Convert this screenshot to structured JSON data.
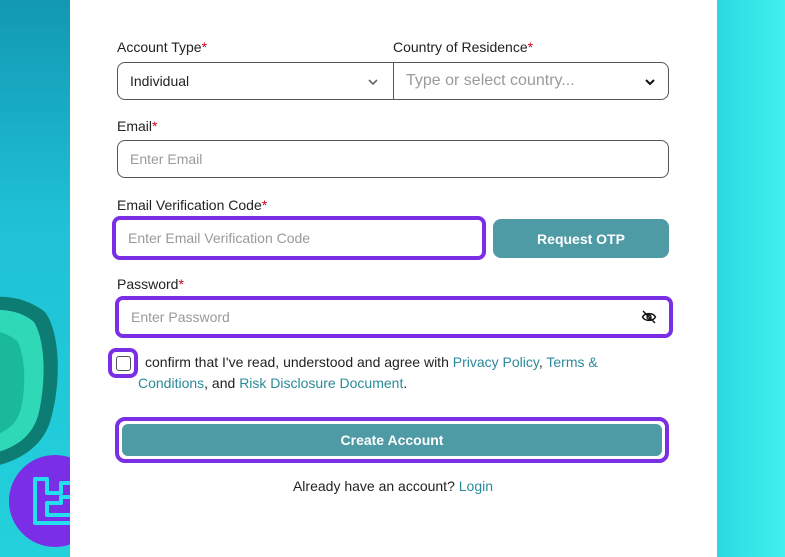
{
  "form": {
    "account_type": {
      "label": "Account Type",
      "required_mark": "*",
      "value": "Individual"
    },
    "country": {
      "label": "Country of Residence",
      "required_mark": "*",
      "placeholder": "Type or select country..."
    },
    "email": {
      "label": "Email",
      "required_mark": "*",
      "placeholder": "Enter Email"
    },
    "verification": {
      "label": "Email Verification Code",
      "required_mark": "*",
      "placeholder": "Enter Email Verification Code",
      "otp_button": "Request OTP"
    },
    "password": {
      "label": "Password",
      "required_mark": "*",
      "placeholder": "Enter Password"
    },
    "consent": {
      "text_before": "confirm that I've read, understood and agree with ",
      "privacy_link": "Privacy Policy",
      "sep1": ", ",
      "terms_link": "Terms & Conditions",
      "sep2": ", and ",
      "risk_link": "Risk Disclosure Document",
      "end": "."
    },
    "create_button": "Create Account",
    "footer": {
      "text": "Already have an account?",
      "login_link": "Login"
    }
  },
  "colors": {
    "accent": "#4e9aa5",
    "highlight": "#7a2ee6",
    "required": "#d0021b",
    "link": "#2b8a9a"
  },
  "icons": [
    "chevron-down-icon",
    "eye-slash-icon",
    "brand-logo"
  ]
}
